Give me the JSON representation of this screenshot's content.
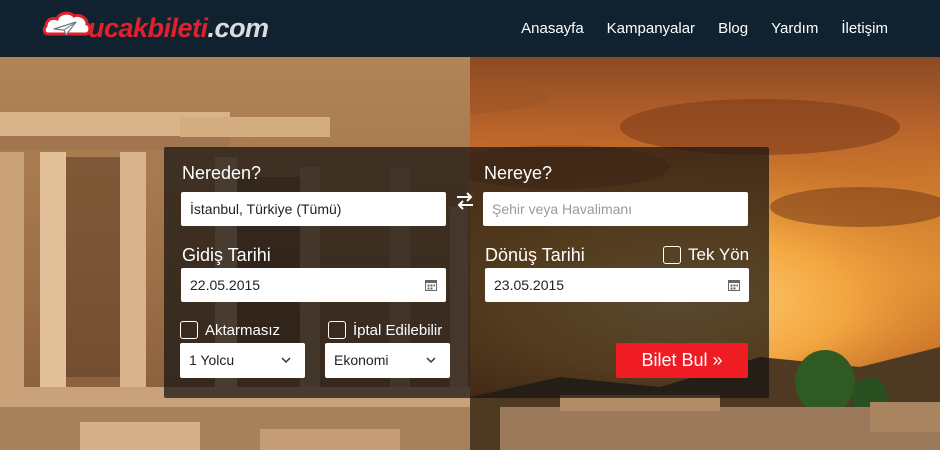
{
  "header": {
    "logo": {
      "brand": "ucakbileti",
      "tld": ".com"
    },
    "nav": [
      "Anasayfa",
      "Kampanyalar",
      "Blog",
      "Yardım",
      "İletişim"
    ]
  },
  "search": {
    "from_label": "Nereden?",
    "from_value": "İstanbul, Türkiye (Tümü)",
    "to_label": "Nereye?",
    "to_placeholder": "Şehir veya Havalimanı",
    "depart_label": "Gidiş Tarihi",
    "depart_value": "22.05.2015",
    "return_label": "Dönüş Tarihi",
    "return_value": "23.05.2015",
    "oneway_label": "Tek Yön",
    "nonstop_label": "Aktarmasız",
    "refundable_label": "İptal Edilebilir",
    "passengers_value": "1 Yolcu",
    "cabin_value": "Ekonomi",
    "submit_label": "Bilet Bul »"
  },
  "colors": {
    "header_bg": "#10222f",
    "brand_red": "#e0212c",
    "button_red": "#ef1c23",
    "panel_bg": "rgba(22,20,18,0.72)"
  },
  "icons": [
    "logo-airplane-icon",
    "swap-arrows-icon",
    "calendar-icon",
    "chevron-down-icon",
    "checkbox-icon"
  ]
}
